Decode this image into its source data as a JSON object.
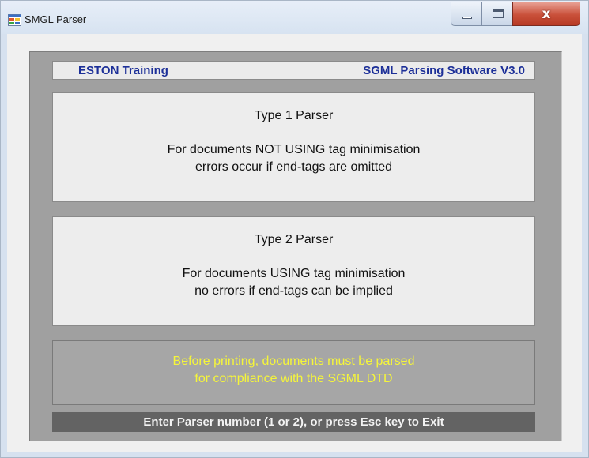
{
  "window": {
    "title": "SMGL Parser",
    "icon": "app-window-icon",
    "controls": {
      "minimize": "minimize-icon",
      "maximize": "maximize-icon",
      "close": "close-icon",
      "close_glyph": "x"
    }
  },
  "header": {
    "left": "ESTON Training",
    "right": "SGML Parsing Software V3.0",
    "color": "#1c2f98"
  },
  "parsers": [
    {
      "title": "Type 1 Parser",
      "line1": "For documents NOT USING tag minimisation",
      "line2": "errors occur if end-tags are omitted"
    },
    {
      "title": "Type 2 Parser",
      "line1": "For documents USING tag minimisation",
      "line2": "no errors if end-tags can be implied"
    }
  ],
  "notice": {
    "line1": "Before printing, documents must be parsed",
    "line2": "for compliance with the SGML DTD",
    "color": "#f5f53a"
  },
  "prompt": {
    "text": "Enter Parser number (1 or 2), or press Esc key to Exit"
  }
}
